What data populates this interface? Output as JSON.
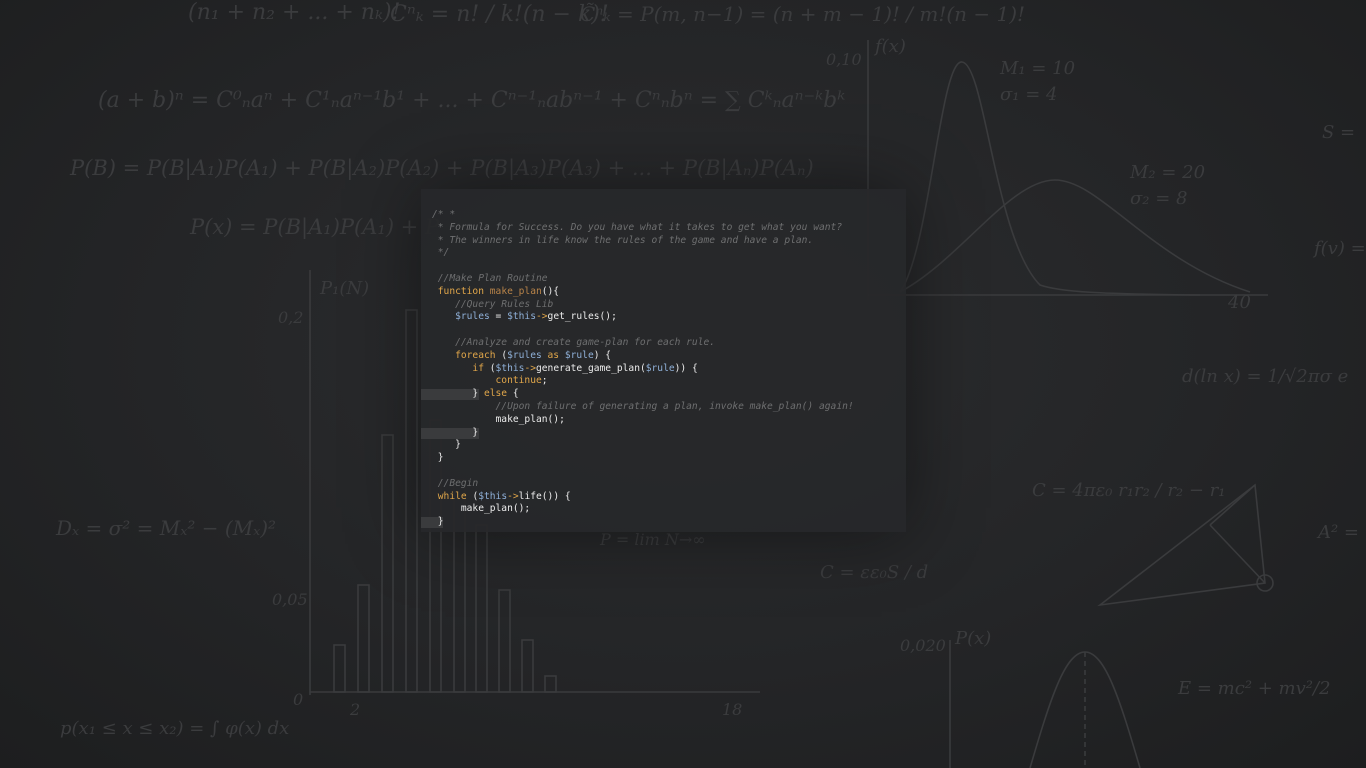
{
  "background": {
    "colors": {
      "base": "#222324",
      "chalk": "#3b3c3e"
    },
    "formulas": [
      "(n₁ + n₂ + ... + nₖ)!",
      "Cⁿₖ = n! / k!(n − k)!",
      "C̃ⁿₖ = P(m, n−1) = (n + m − 1)! / m!(n − 1)!",
      "(a + b)ⁿ = C⁰ₙaⁿ + C¹ₙaⁿ⁻¹b¹ + ... + Cⁿ⁻¹ₙabⁿ⁻¹ + Cⁿₙbⁿ = ∑ Cᵏₙaⁿ⁻ᵏbᵏ",
      "P(B) = P(B|A₁)P(A₁) + P(B|A₂)P(A₂) + P(B|A₃)P(A₃) + ... + P(B|Aₙ)P(Aₙ)",
      "P(x) = P(B|A₁)P(A₁) + P",
      "M₁ = 10",
      "σ₁ = 4",
      "M₂ = 20",
      "σ₂ = 8",
      "f(x)",
      "0,10",
      "0,2",
      "0,05",
      "0,020",
      "P₁(N)",
      "P(x)",
      "40",
      "2",
      "18",
      "0",
      "Dₓ = σ² = Mₓ² − (Mₓ)²",
      "p(x₁ ≤ x ≤ x₂) = ∫ φ(x) dx",
      "C = 4πε₀ r₁r₂ / r₂ − r₁",
      "C = εε₀S / d",
      "E = mc² + mv²/2",
      "d(ln x) = 1/√2πσ e",
      "S =",
      "f(v) =",
      "A² =",
      "P = lim N→∞"
    ]
  },
  "editor": {
    "panel_color": "#27282a",
    "colors": {
      "comment": "#6e6f70",
      "keyword": "#e0a64a",
      "function_name": "#b98449",
      "variable": "#8fb0d8",
      "plain": "#ececec"
    },
    "lines": [
      {
        "tokens": [
          {
            "t": "/* *",
            "k": "cm"
          }
        ]
      },
      {
        "tokens": [
          {
            "t": " * Formula for Success. Do you have what it takes to get what you want?",
            "k": "cm"
          }
        ]
      },
      {
        "tokens": [
          {
            "t": " * The winners in life know the rules of the game and have a plan.",
            "k": "cm"
          }
        ]
      },
      {
        "tokens": [
          {
            "t": " */",
            "k": "cm"
          }
        ]
      },
      {
        "tokens": []
      },
      {
        "tokens": [
          {
            "t": " //Make Plan Routine",
            "k": "cm"
          }
        ]
      },
      {
        "tokens": [
          {
            "t": " function ",
            "k": "kw"
          },
          {
            "t": "make_plan",
            "k": "fn"
          },
          {
            "t": "(){",
            "k": "pl"
          }
        ]
      },
      {
        "tokens": [
          {
            "t": "    //Query Rules Lib",
            "k": "cm"
          }
        ]
      },
      {
        "tokens": [
          {
            "t": "    ",
            "k": "pl"
          },
          {
            "t": "$rules",
            "k": "vr"
          },
          {
            "t": " = ",
            "k": "pl"
          },
          {
            "t": "$this",
            "k": "vr"
          },
          {
            "t": "->",
            "k": "kw"
          },
          {
            "t": "get_rules();",
            "k": "pl"
          }
        ]
      },
      {
        "tokens": []
      },
      {
        "tokens": [
          {
            "t": "    //Analyze and create game-plan for each rule.",
            "k": "cm"
          }
        ]
      },
      {
        "tokens": [
          {
            "t": "    foreach ",
            "k": "kw"
          },
          {
            "t": "(",
            "k": "pl"
          },
          {
            "t": "$rules",
            "k": "vr"
          },
          {
            "t": " as ",
            "k": "kw"
          },
          {
            "t": "$rule",
            "k": "vr"
          },
          {
            "t": ") {",
            "k": "pl"
          }
        ]
      },
      {
        "tokens": [
          {
            "t": "       if ",
            "k": "kw"
          },
          {
            "t": "(",
            "k": "pl"
          },
          {
            "t": "$this",
            "k": "vr"
          },
          {
            "t": "->",
            "k": "kw"
          },
          {
            "t": "generate_game_plan(",
            "k": "pl"
          },
          {
            "t": "$rule",
            "k": "vr"
          },
          {
            "t": ")) {",
            "k": "pl"
          }
        ]
      },
      {
        "tokens": [
          {
            "t": "           continue",
            "k": "kw"
          },
          {
            "t": ";",
            "k": "pl"
          }
        ]
      },
      {
        "tokens": [
          {
            "t": "       } ",
            "k": "pl"
          },
          {
            "t": "else",
            "k": "kw"
          },
          {
            "t": " {",
            "k": "pl"
          }
        ]
      },
      {
        "tokens": [
          {
            "t": "           //Upon failure of generating a plan, invoke make_plan() again!",
            "k": "cm"
          }
        ]
      },
      {
        "tokens": [
          {
            "t": "           make_plan();",
            "k": "pl"
          }
        ]
      },
      {
        "tokens": [
          {
            "t": "       }",
            "k": "pl"
          }
        ]
      },
      {
        "tokens": [
          {
            "t": "    }",
            "k": "pl"
          }
        ]
      },
      {
        "tokens": [
          {
            "t": " }",
            "k": "pl"
          }
        ]
      },
      {
        "tokens": []
      },
      {
        "tokens": [
          {
            "t": " //Begin",
            "k": "cm"
          }
        ]
      },
      {
        "tokens": [
          {
            "t": " while ",
            "k": "kw"
          },
          {
            "t": "(",
            "k": "pl"
          },
          {
            "t": "$this",
            "k": "vr"
          },
          {
            "t": "->",
            "k": "kw"
          },
          {
            "t": "life()) {",
            "k": "pl"
          }
        ]
      },
      {
        "tokens": [
          {
            "t": "     make_plan();",
            "k": "pl"
          }
        ]
      },
      {
        "tokens": [
          {
            "t": " }",
            "k": "pl"
          }
        ]
      }
    ]
  }
}
